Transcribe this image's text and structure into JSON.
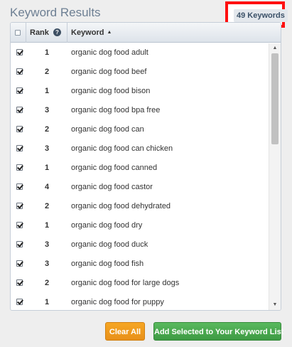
{
  "header": {
    "title": "Keyword Results",
    "keyword_count": "49 Keywords"
  },
  "table": {
    "columns": {
      "rank": "Rank",
      "keyword": "Keyword"
    },
    "rows": [
      {
        "checked": true,
        "rank": "1",
        "keyword": "organic dog food adult"
      },
      {
        "checked": true,
        "rank": "2",
        "keyword": "organic dog food beef"
      },
      {
        "checked": true,
        "rank": "1",
        "keyword": "organic dog food bison"
      },
      {
        "checked": true,
        "rank": "3",
        "keyword": "organic dog food bpa free"
      },
      {
        "checked": true,
        "rank": "2",
        "keyword": "organic dog food can"
      },
      {
        "checked": true,
        "rank": "3",
        "keyword": "organic dog food can chicken"
      },
      {
        "checked": true,
        "rank": "1",
        "keyword": "organic dog food canned"
      },
      {
        "checked": true,
        "rank": "4",
        "keyword": "organic dog food castor"
      },
      {
        "checked": true,
        "rank": "2",
        "keyword": "organic dog food dehydrated"
      },
      {
        "checked": true,
        "rank": "1",
        "keyword": "organic dog food dry"
      },
      {
        "checked": true,
        "rank": "3",
        "keyword": "organic dog food duck"
      },
      {
        "checked": true,
        "rank": "3",
        "keyword": "organic dog food fish"
      },
      {
        "checked": true,
        "rank": "2",
        "keyword": "organic dog food for large dogs"
      },
      {
        "checked": true,
        "rank": "1",
        "keyword": "organic dog food for puppy"
      }
    ]
  },
  "buttons": {
    "clear_all": "Clear All",
    "add_selected": "Add Selected to Your Keyword List"
  },
  "colors": {
    "title": "#6d7f93",
    "highlight_border": "#ff1010",
    "clear_button": "#f0a020",
    "add_button": "#4caf50"
  },
  "icons": {
    "help": "question-circle-icon",
    "sort": "sort-ascending-icon",
    "scroll_up": "arrow-up-icon",
    "scroll_down": "arrow-down-icon"
  }
}
